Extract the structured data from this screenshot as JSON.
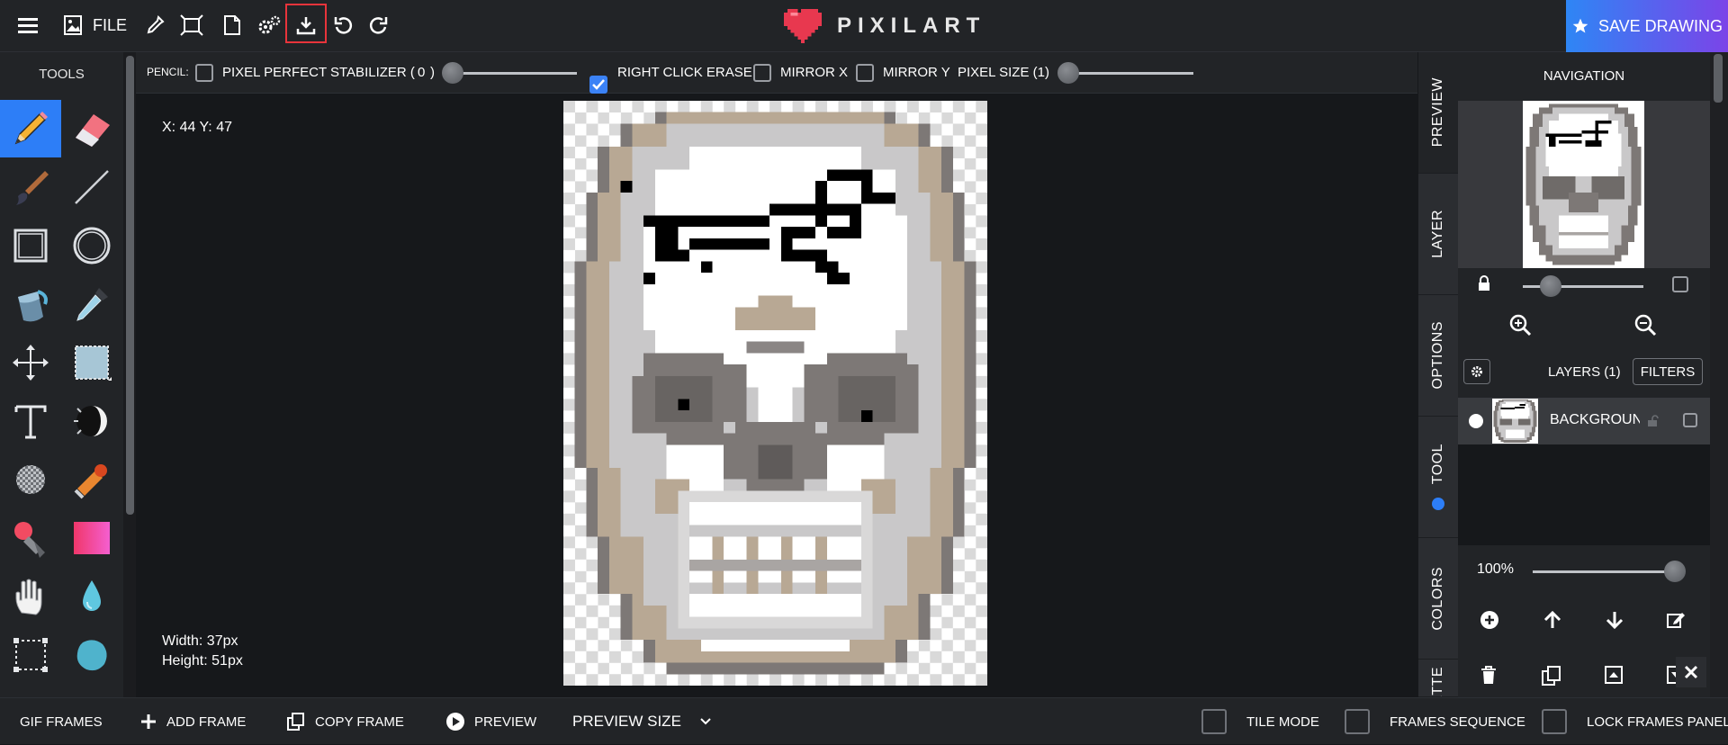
{
  "topbar": {
    "file_label": "FILE",
    "logo_text": "PIXILART",
    "save_label": "SAVE DRAWING"
  },
  "tools": {
    "title": "TOOLS",
    "items": [
      "pencil",
      "eraser",
      "brush",
      "line",
      "rectangle",
      "ellipse",
      "bucket-fill",
      "eyedropper",
      "move",
      "select-color",
      "text",
      "shading",
      "dither",
      "stamp",
      "spray-paint",
      "gradient",
      "hand-pan",
      "water-drop",
      "marquee-select",
      "lasso"
    ],
    "active": "pencil"
  },
  "options": {
    "tool_name": "PENCIL:",
    "pixel_perfect": "PIXEL PERFECT",
    "pixel_perfect_checked": false,
    "stabilizer_label": "STABILIZER (",
    "stabilizer_value": "0",
    "stabilizer_close": ")",
    "right_click_erase": "RIGHT CLICK ERASE",
    "right_click_erase_checked": true,
    "mirror_x": "MIRROR X",
    "mirror_y": "MIRROR Y",
    "pixel_size_label": "PIXEL SIZE (1)"
  },
  "canvas": {
    "coords": "X: 44 Y: 47",
    "width_label": "Width: 37px",
    "height_label": "Height: 51px"
  },
  "right_tabs": [
    "PREVIEW",
    "LAYER",
    "OPTIONS",
    "TOOL",
    "COLORS",
    "PALETTE"
  ],
  "navigation": {
    "title": "NAVIGATION"
  },
  "layers": {
    "title": "LAYERS (1)",
    "filters_label": "FILTERS",
    "items": [
      {
        "name": "BACKGROUND"
      }
    ],
    "opacity": "100%"
  },
  "bottombar": {
    "gif_frames": "GIF FRAMES",
    "add_frame": "ADD FRAME",
    "copy_frame": "COPY FRAME",
    "preview": "PREVIEW",
    "preview_size": "PREVIEW SIZE",
    "tile_mode": "TILE MODE",
    "frames_sequence": "FRAMES SEQUENCE",
    "lock_frames_panel": "LOCK FRAMES PANEL"
  },
  "colors": {
    "accent": "#2d7ef7",
    "save_gradient_start": "#2e86f5",
    "save_gradient_end": "#7b44e8",
    "logo_heart": "#e8384f",
    "highlight": "#e8343b"
  }
}
